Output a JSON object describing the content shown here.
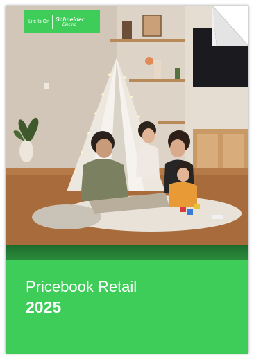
{
  "logo": {
    "tagline": "Life Is On",
    "brand_name": "Schneider",
    "brand_sub": "Electric"
  },
  "cover": {
    "title": "Pricebook Retail",
    "year": "2025"
  },
  "colors": {
    "brand_green": "#3dcd58",
    "dark_green_band": "#247d34"
  },
  "icons": [
    "page-curl-icon"
  ]
}
